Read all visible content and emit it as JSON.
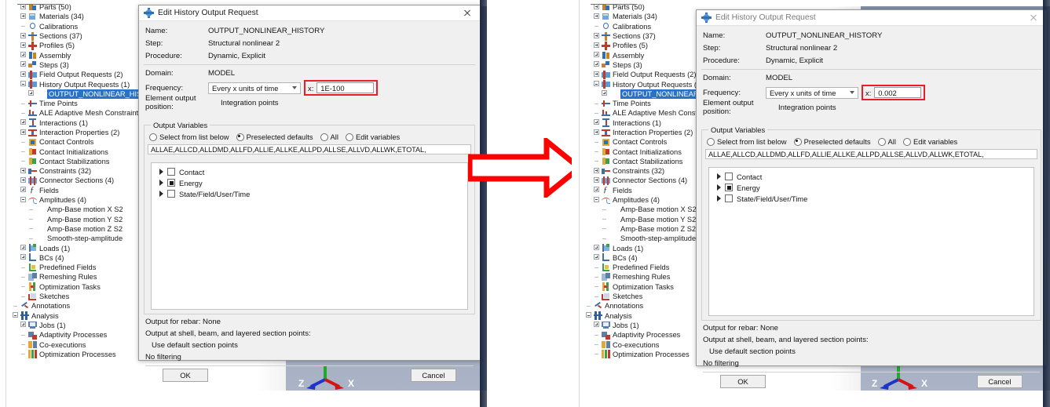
{
  "meta": {
    "accent_red": "#ec1c24",
    "select_blue": "#2a72c8",
    "viewport_bg": "#93a0b6"
  },
  "tree": {
    "items": [
      {
        "label": "Parts (50)",
        "icon": "parts-icon",
        "expander": "plus",
        "indent": 1
      },
      {
        "label": "Materials (34)",
        "icon": "materials-icon",
        "expander": "plus",
        "indent": 1
      },
      {
        "label": "Calibrations",
        "icon": "calibrations-icon",
        "expander": "dash",
        "indent": 1
      },
      {
        "label": "Sections (37)",
        "icon": "sections-icon",
        "expander": "plus",
        "indent": 1
      },
      {
        "label": "Profiles (5)",
        "icon": "profiles-icon",
        "expander": "plus",
        "indent": 1
      },
      {
        "label": "Assembly",
        "icon": "assembly-icon",
        "expander": "plus",
        "indent": 1
      },
      {
        "label": "Steps (3)",
        "icon": "steps-icon",
        "expander": "plus",
        "indent": 1
      },
      {
        "label": "Field Output Requests (2)",
        "icon": "field-output-icon",
        "expander": "plus",
        "indent": 1
      },
      {
        "label": "History Output Requests (1)",
        "icon": "history-output-icon",
        "expander": "minus",
        "indent": 1
      },
      {
        "label": "OUTPUT_NONLINEAR_HISTORY",
        "icon": "none",
        "expander": "plus",
        "indent": 2,
        "selected": true
      },
      {
        "label": "Time Points",
        "icon": "time-points-icon",
        "expander": "dash",
        "indent": 1
      },
      {
        "label": "ALE Adaptive Mesh Constraints",
        "icon": "ale-icon",
        "expander": "dash",
        "indent": 1
      },
      {
        "label": "Interactions (1)",
        "icon": "interactions-icon",
        "expander": "plus",
        "indent": 1
      },
      {
        "label": "Interaction Properties (2)",
        "icon": "interaction-properties-icon",
        "expander": "plus",
        "indent": 1
      },
      {
        "label": "Contact Controls",
        "icon": "contact-controls-icon",
        "expander": "dash",
        "indent": 1
      },
      {
        "label": "Contact Initializations",
        "icon": "contact-initializations-icon",
        "expander": "dash",
        "indent": 1
      },
      {
        "label": "Contact Stabilizations",
        "icon": "contact-stabilizations-icon",
        "expander": "dash",
        "indent": 1
      },
      {
        "label": "Constraints (32)",
        "icon": "constraints-icon",
        "expander": "plus",
        "indent": 1
      },
      {
        "label": "Connector Sections (4)",
        "icon": "connector-sections-icon",
        "expander": "plus",
        "indent": 1
      },
      {
        "label": "Fields",
        "icon": "fields-icon",
        "expander": "plus",
        "indent": 1
      },
      {
        "label": "Amplitudes (4)",
        "icon": "amplitudes-icon",
        "expander": "minus",
        "indent": 1
      },
      {
        "label": "Amp-Base motion X S2",
        "icon": "none",
        "expander": "dash",
        "indent": 2
      },
      {
        "label": "Amp-Base motion Y S2",
        "icon": "none",
        "expander": "dash",
        "indent": 2
      },
      {
        "label": "Amp-Base motion Z S2",
        "icon": "none",
        "expander": "dash",
        "indent": 2
      },
      {
        "label": "Smooth-step-amplitude",
        "icon": "none",
        "expander": "dash",
        "indent": 2
      },
      {
        "label": "Loads (1)",
        "icon": "loads-icon",
        "expander": "plus",
        "indent": 1
      },
      {
        "label": "BCs (4)",
        "icon": "bcs-icon",
        "expander": "plus",
        "indent": 1
      },
      {
        "label": "Predefined Fields",
        "icon": "predefined-fields-icon",
        "expander": "dash",
        "indent": 1
      },
      {
        "label": "Remeshing Rules",
        "icon": "remeshing-rules-icon",
        "expander": "dash",
        "indent": 1
      },
      {
        "label": "Optimization Tasks",
        "icon": "optimization-tasks-icon",
        "expander": "dash",
        "indent": 1
      },
      {
        "label": "Sketches",
        "icon": "sketches-icon",
        "expander": "dash",
        "indent": 1
      },
      {
        "label": "Annotations",
        "icon": "annotations-icon",
        "expander": "dash",
        "indent": 0
      },
      {
        "label": "Analysis",
        "icon": "analysis-icon",
        "expander": "minus",
        "indent": 0
      },
      {
        "label": "Jobs (1)",
        "icon": "jobs-icon",
        "expander": "plus",
        "indent": 1
      },
      {
        "label": "Adaptivity Processes",
        "icon": "adaptivity-icon",
        "expander": "dash",
        "indent": 1
      },
      {
        "label": "Co-executions",
        "icon": "coexecutions-icon",
        "expander": "dash",
        "indent": 1
      },
      {
        "label": "Optimization Processes",
        "icon": "optimization-processes-icon",
        "expander": "dash",
        "indent": 1
      }
    ]
  },
  "dialog": {
    "title": "Edit History Output Request",
    "title_icon": "abaqus-icon",
    "close_icon": "close-icon",
    "fields": {
      "name_label": "Name:",
      "name_value": "OUTPUT_NONLINEAR_HISTORY",
      "step_label": "Step:",
      "step_value": "Structural nonlinear 2",
      "procedure_label": "Procedure:",
      "procedure_value": "Dynamic, Explicit",
      "domain_label": "Domain:",
      "domain_value": "MODEL",
      "frequency_label": "Frequency:",
      "frequency_value": "Every x units of time",
      "x_label": "x:",
      "element_position_label": "Element output position:",
      "element_position_value": "Integration points"
    },
    "output_variables": {
      "group_title": "Output Variables",
      "radios": [
        {
          "label": "Select from list below",
          "selected": false
        },
        {
          "label": "Preselected defaults",
          "selected": true
        },
        {
          "label": "All",
          "selected": false
        },
        {
          "label": "Edit variables",
          "selected": false
        }
      ],
      "variables_text": "ALLAE,ALLCD,ALLDMD,ALLFD,ALLIE,ALLKE,ALLPD,ALLSE,ALLVD,ALLWK,ETOTAL,",
      "categories": [
        {
          "label": "Contact",
          "state": "unchecked"
        },
        {
          "label": "Energy",
          "state": "partial"
        },
        {
          "label": "State/Field/User/Time",
          "state": "unchecked"
        }
      ]
    },
    "footer": {
      "rebar": "Output for rebar:  None",
      "shell": "Output at shell, beam, and layered section points:",
      "section_points": "Use default section points",
      "filtering": "No filtering",
      "ok_label": "OK",
      "cancel_label": "Cancel"
    }
  },
  "left_panel": {
    "x_value": "1E-100"
  },
  "right_panel": {
    "x_value": "0.002"
  },
  "viewport": {
    "axis_z_label": "Z",
    "axis_x_label": "X",
    "triad_icon": "axis-triad-icon"
  },
  "annotation": {
    "arrow_icon": "right-arrow-annotation",
    "arrow_color": "#ff0000"
  }
}
